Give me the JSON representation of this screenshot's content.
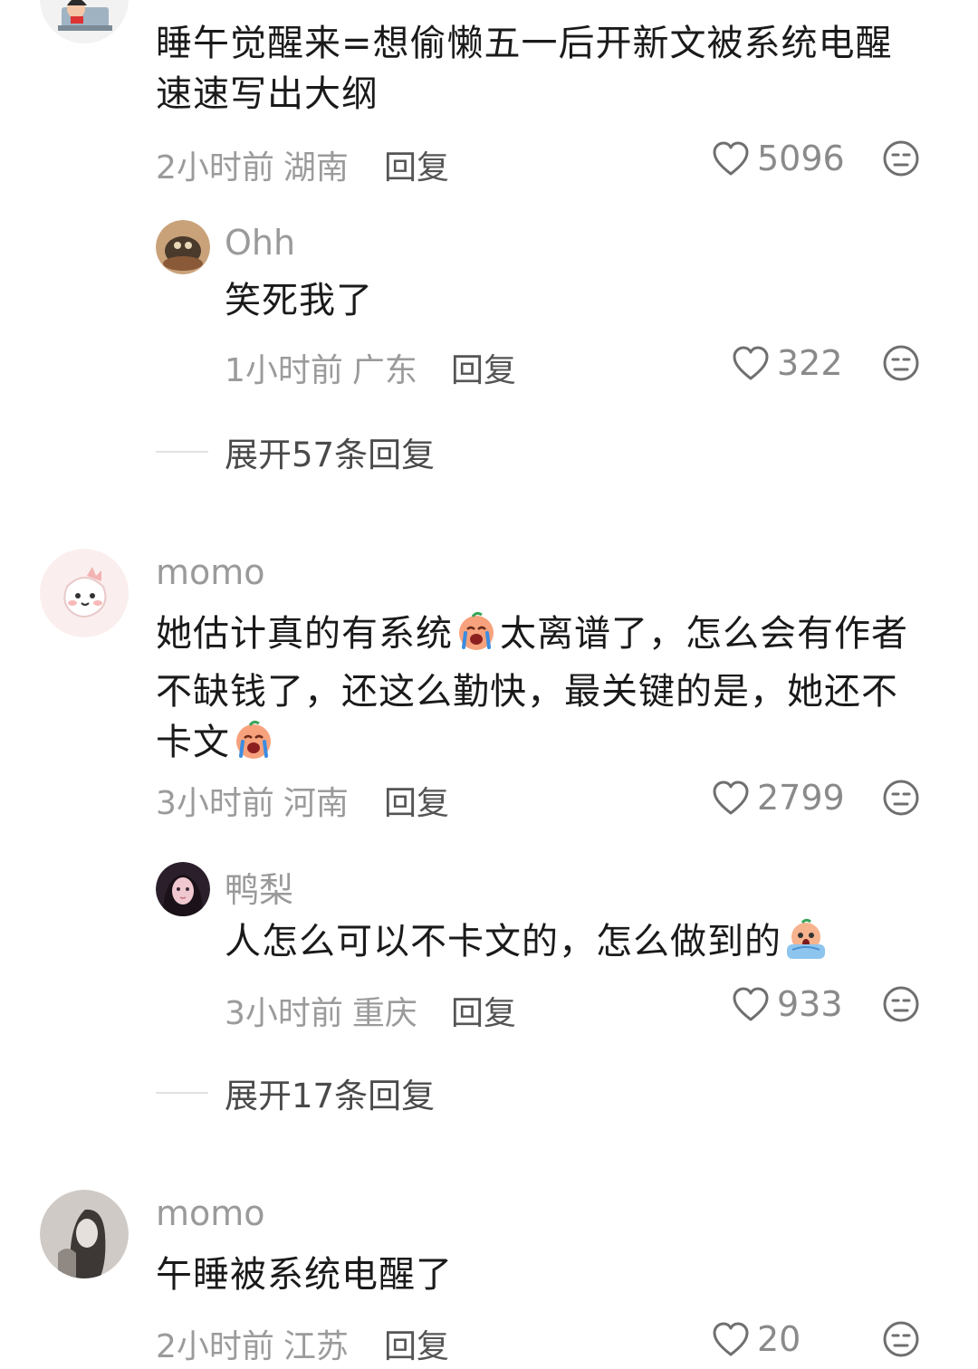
{
  "comments": [
    {
      "username": "",
      "text": "睡午觉醒来=想偷懒五一后开新文被系统电醒速速写出大纲",
      "time": "2小时前",
      "location": "湖南",
      "reply_label": "回复",
      "likes": "5096",
      "replies": [
        {
          "username": "Ohh",
          "text": "笑死我了",
          "time": "1小时前",
          "location": "广东",
          "reply_label": "回复",
          "likes": "322"
        }
      ],
      "expand_label": "展开57条回复"
    },
    {
      "username": "momo",
      "text_parts": [
        "她估计真的有系统",
        "太离谱了，怎么会有作者",
        "不缺钱了，还这么勤快，最关键的是，她还不",
        "卡文"
      ],
      "time": "3小时前",
      "location": "河南",
      "reply_label": "回复",
      "likes": "2799",
      "replies": [
        {
          "username": "鸭梨",
          "text": "人怎么可以不卡文的，怎么做到的",
          "time": "3小时前",
          "location": "重庆",
          "reply_label": "回复",
          "likes": "933"
        }
      ],
      "expand_label": "展开17条回复"
    },
    {
      "username": "momo",
      "text": "午睡被系统电醒了",
      "time": "2小时前",
      "location": "江苏",
      "reply_label": "回复",
      "likes": "20"
    }
  ],
  "icons": {
    "like": "heart-outline-icon",
    "dislike": "meh-face-icon",
    "emoji_crying": "crying-emoji-icon",
    "emoji_shocked": "shocked-emoji-icon"
  },
  "colors": {
    "text": "#1a1a1a",
    "muted": "#9b9b9b",
    "icon": "#6f6f6f"
  }
}
